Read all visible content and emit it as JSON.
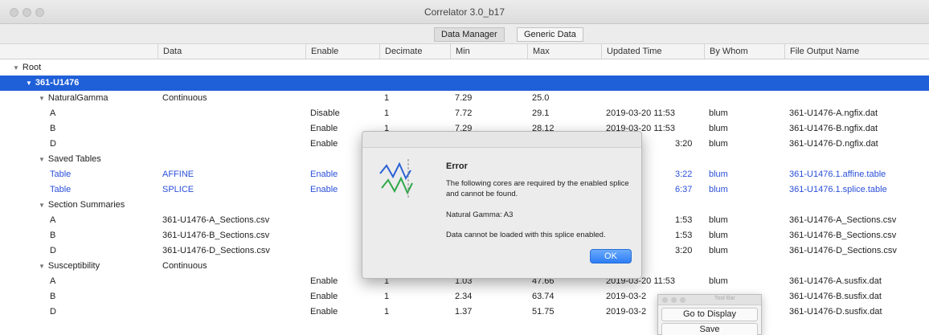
{
  "window": {
    "title": "Correlator 3.0_b17"
  },
  "tabs": [
    {
      "label": "Data Manager",
      "selected": true
    },
    {
      "label": "Generic Data",
      "selected": false
    }
  ],
  "columns": {
    "data": "Data",
    "enable": "Enable",
    "decimate": "Decimate",
    "min": "Min",
    "max": "Max",
    "updated": "Updated Time",
    "by": "By Whom",
    "output": "File Output Name"
  },
  "tree": {
    "root": "Root",
    "site": "361-U1476",
    "natural_gamma": {
      "label": "NaturalGamma",
      "data": "Continuous",
      "decimate": "1",
      "min": "7.29",
      "max": "25.0",
      "rows": [
        {
          "name": "A",
          "enable": "Disable",
          "decimate": "1",
          "min": "7.72",
          "max": "29.1",
          "updated": "2019-03-20 11:53",
          "by": "blum",
          "output": "361-U1476-A.ngfix.dat"
        },
        {
          "name": "B",
          "enable": "Enable",
          "decimate": "1",
          "min": "7.29",
          "max": "28.12",
          "updated": "2019-03-20 11:53",
          "by": "blum",
          "output": "361-U1476-B.ngfix.dat"
        },
        {
          "name": "D",
          "enable": "Enable",
          "decimate": "",
          "min": "",
          "max": "",
          "updated": "3:20",
          "by": "blum",
          "output": "361-U1476-D.ngfix.dat"
        }
      ]
    },
    "saved_tables": {
      "label": "Saved Tables",
      "rows": [
        {
          "name": "Table",
          "data": "AFFINE",
          "enable": "Enable",
          "updated": "3:22",
          "by": "blum",
          "output": "361-U1476.1.affine.table"
        },
        {
          "name": "Table",
          "data": "SPLICE",
          "enable": "Enable",
          "updated": "6:37",
          "by": "blum",
          "output": "361-U1476.1.splice.table"
        }
      ]
    },
    "section_summaries": {
      "label": "Section Summaries",
      "rows": [
        {
          "name": "A",
          "data": "361-U1476-A_Sections.csv",
          "updated": "1:53",
          "by": "blum",
          "output": "361-U1476-A_Sections.csv"
        },
        {
          "name": "B",
          "data": "361-U1476-B_Sections.csv",
          "updated": "1:53",
          "by": "blum",
          "output": "361-U1476-B_Sections.csv"
        },
        {
          "name": "D",
          "data": "361-U1476-D_Sections.csv",
          "updated": "3:20",
          "by": "blum",
          "output": "361-U1476-D_Sections.csv"
        }
      ]
    },
    "susceptibility": {
      "label": "Susceptibility",
      "data": "Continuous",
      "rows": [
        {
          "name": "A",
          "enable": "Enable",
          "decimate": "1",
          "min": "1.03",
          "max": "47.66",
          "updated": "2019-03-20 11:53",
          "by": "blum",
          "output": "361-U1476-A.susfix.dat"
        },
        {
          "name": "B",
          "enable": "Enable",
          "decimate": "1",
          "min": "2.34",
          "max": "63.74",
          "updated": "2019-03-2",
          "by": "",
          "output": "361-U1476-B.susfix.dat"
        },
        {
          "name": "D",
          "enable": "Enable",
          "decimate": "1",
          "min": "1.37",
          "max": "51.75",
          "updated": "2019-03-2",
          "by": "",
          "output": "361-U1476-D.susfix.dat"
        }
      ]
    }
  },
  "dialog": {
    "title": "Error",
    "message": "The following cores are required by the enabled splice and cannot be found.",
    "detail": "Natural Gamma: A3",
    "note": "Data cannot be loaded with this splice enabled.",
    "ok": "OK"
  },
  "toolbar": {
    "title": "Tool Bar",
    "go_to_display": "Go to Display",
    "save": "Save"
  },
  "colors": {
    "selection": "#1f5fd8",
    "link_blue": "#2a4fd8",
    "ok_button": "#2d7df5"
  }
}
